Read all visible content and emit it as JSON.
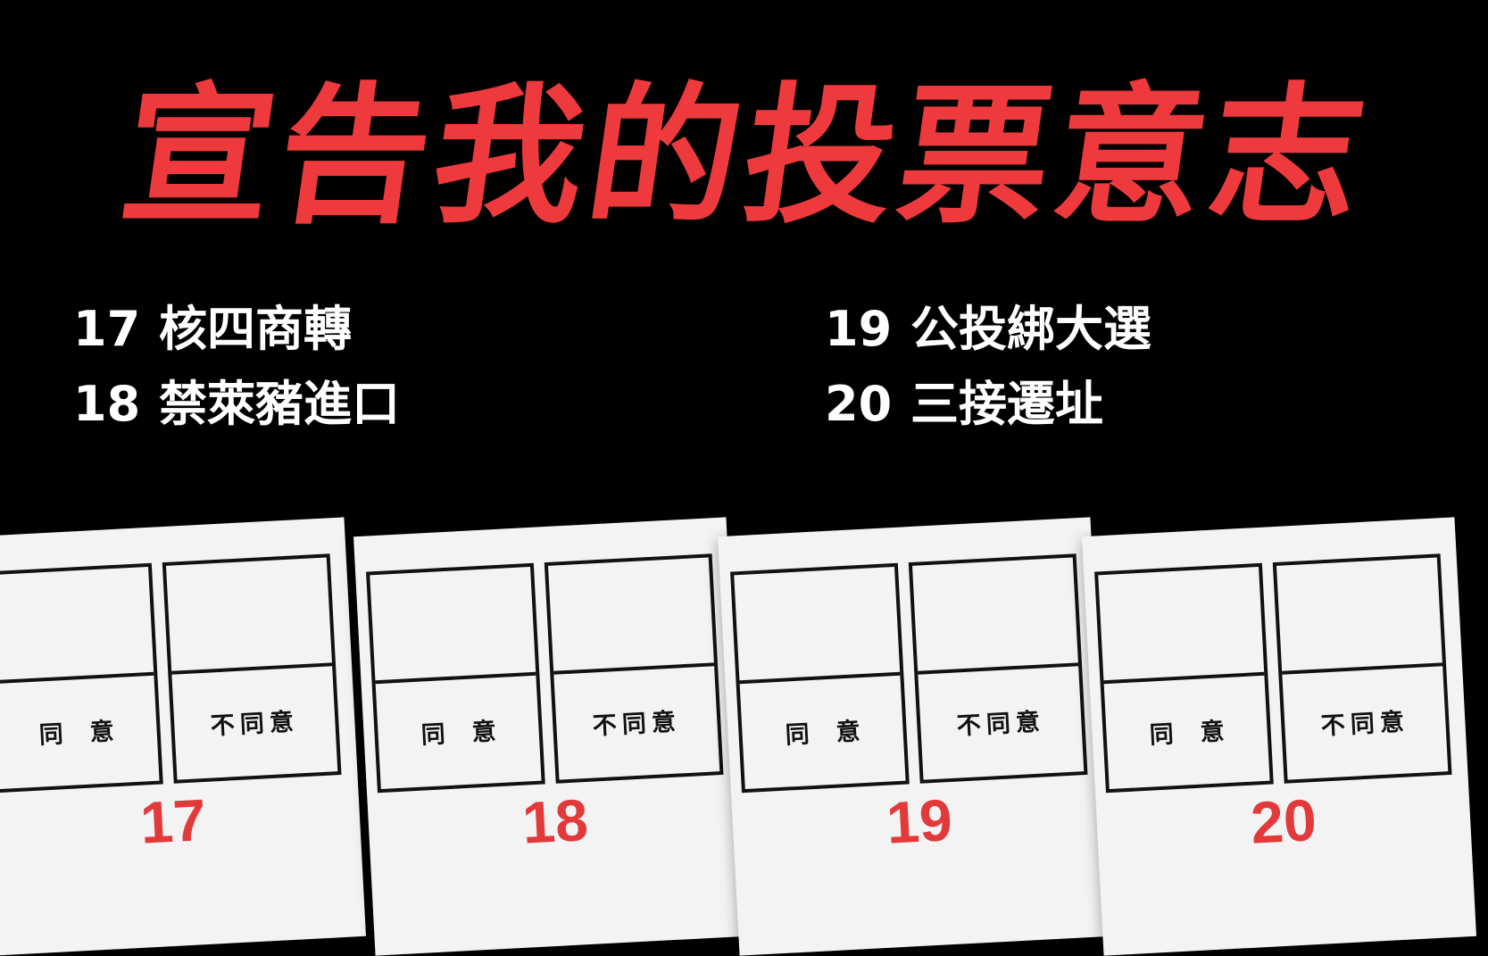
{
  "headline": "宣告我的投票意志",
  "topics": [
    {
      "number": "17",
      "title": "核四商轉"
    },
    {
      "number": "18",
      "title": "禁萊豬進口"
    },
    {
      "number": "19",
      "title": "公投綁大選"
    },
    {
      "number": "20",
      "title": "三接遷址"
    }
  ],
  "ballot": {
    "agree_label": "同意",
    "disagree_label": "不同意"
  },
  "colors": {
    "background": "#000000",
    "headline": "#ee3a3c",
    "ballot_number": "#e23a3a",
    "paper": "#f3f3f3"
  }
}
